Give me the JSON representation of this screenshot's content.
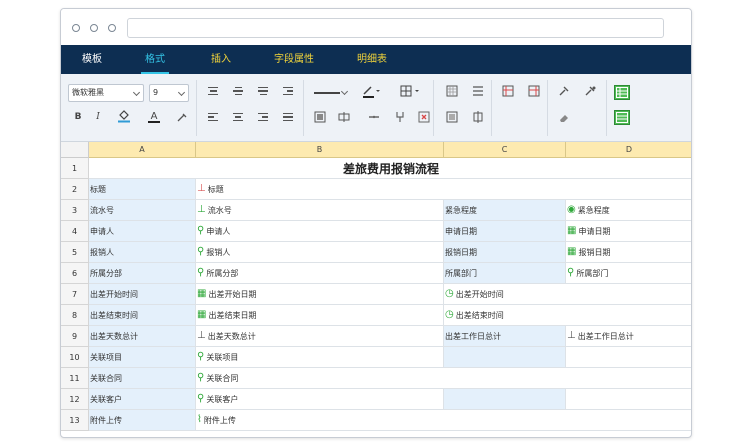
{
  "menubar": {
    "items": [
      {
        "label": "模板"
      },
      {
        "label": "格式"
      },
      {
        "label": "插入"
      },
      {
        "label": "字段属性"
      },
      {
        "label": "明细表"
      }
    ]
  },
  "toolbar": {
    "font_family": "微软雅黑",
    "font_size": "9",
    "bold_label": "B",
    "italic_label": "I",
    "font_color_label": "A"
  },
  "sheet": {
    "columns": [
      "A",
      "B",
      "C",
      "D"
    ],
    "title": "差旅费用报销流程",
    "rows": [
      {
        "num": "1"
      },
      {
        "num": "2",
        "a": "标题",
        "b": "标题"
      },
      {
        "num": "3",
        "a": "流水号",
        "b": "流水号",
        "c": "紧急程度",
        "d": "紧急程度"
      },
      {
        "num": "4",
        "a": "申请人",
        "b": "申请人",
        "c": "申请日期",
        "d": "申请日期"
      },
      {
        "num": "5",
        "a": "报销人",
        "b": "报销人",
        "c": "报销日期",
        "d": "报销日期"
      },
      {
        "num": "6",
        "a": "所属分部",
        "b": "所属分部",
        "c": "所属部门",
        "d": "所属部门"
      },
      {
        "num": "7",
        "a": "出差开始时间",
        "b": "出差开始日期",
        "c": "出差开始时间"
      },
      {
        "num": "8",
        "a": "出差结束时间",
        "b": "出差结束日期",
        "c": "出差结束时间"
      },
      {
        "num": "9",
        "a": "出差天数总计",
        "b": "出差天数总计",
        "c": "出差工作日总计",
        "d": "出差工作日总计"
      },
      {
        "num": "10",
        "a": "关联项目",
        "b": "关联项目"
      },
      {
        "num": "11",
        "a": "关联合同",
        "b": "关联合同"
      },
      {
        "num": "12",
        "a": "关联客户",
        "b": "关联客户"
      },
      {
        "num": "13",
        "a": "附件上传",
        "b": "附件上传"
      }
    ]
  }
}
